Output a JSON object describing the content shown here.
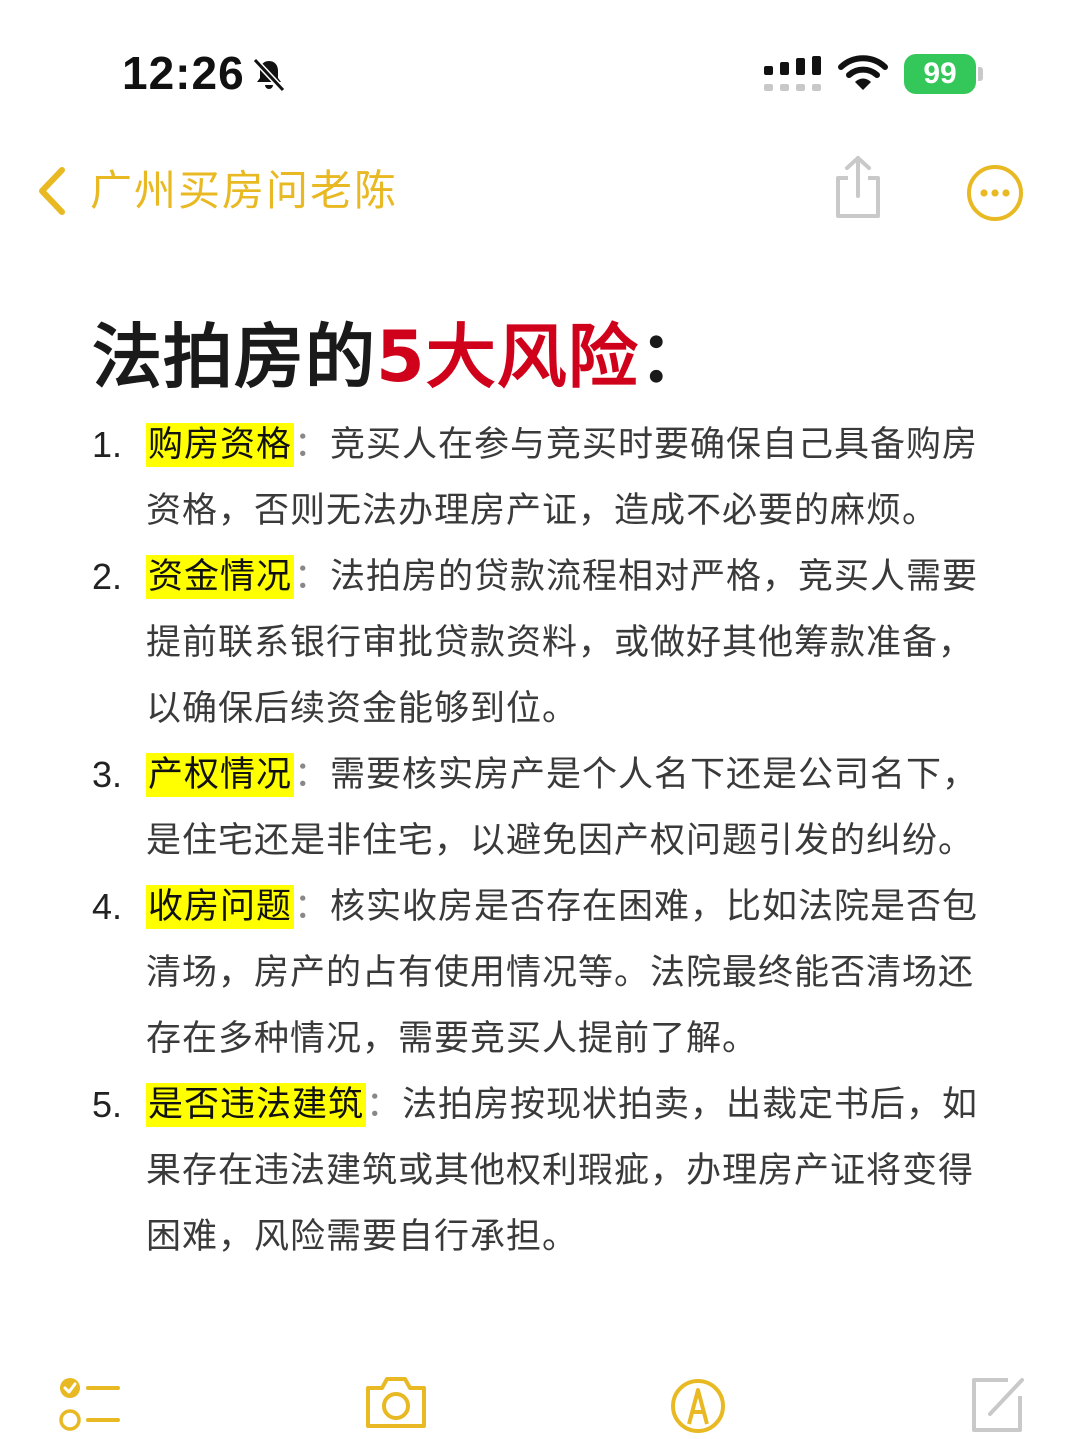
{
  "status_bar": {
    "time": "12:26",
    "battery": "99"
  },
  "nav": {
    "title": "广州买房问老陈",
    "accent_color": "#e8b923",
    "icons": [
      "chevron-left-icon",
      "share-icon",
      "more-icon"
    ]
  },
  "content": {
    "title_prefix": "法拍房的",
    "title_highlight": "5大风险",
    "title_suffix": "：",
    "items": [
      {
        "num": "1.",
        "keyword": "购房资格",
        "sep": "：",
        "text": "竞买人在参与竞买时要确保自己具备购房资格，否则无法办理房产证，造成不必要的麻烦。"
      },
      {
        "num": "2.",
        "keyword": "资金情况",
        "sep": "：",
        "text": "法拍房的贷款流程相对严格，竞买人需要提前联系银行审批贷款资料，或做好其他筹款准备，以确保后续资金能够到位。"
      },
      {
        "num": "3.",
        "keyword": "产权情况",
        "sep": "：",
        "text": "需要核实房产是个人名下还是公司名下，是住宅还是非住宅，以避免因产权问题引发的纠纷。"
      },
      {
        "num": "4.",
        "keyword": "收房问题",
        "sep": "：",
        "text": "核实收房是否存在困难，比如法院是否包清场，房产的占有使用情况等。法院最终能否清场还存在多种情况，需要竞买人提前了解。"
      },
      {
        "num": "5.",
        "keyword": "是否违法建筑",
        "sep": "：",
        "text": "法拍房按现状拍卖，出裁定书后，如果存在违法建筑或其他权利瑕疵，办理房产证将变得困难，风险需要自行承担。"
      }
    ]
  },
  "toolbar": {
    "icons": [
      "checklist-icon",
      "camera-icon",
      "markup-icon",
      "compose-icon"
    ]
  },
  "colors": {
    "highlight": "#ffff00",
    "title_red": "#d0021b",
    "battery_green": "#34c759"
  }
}
